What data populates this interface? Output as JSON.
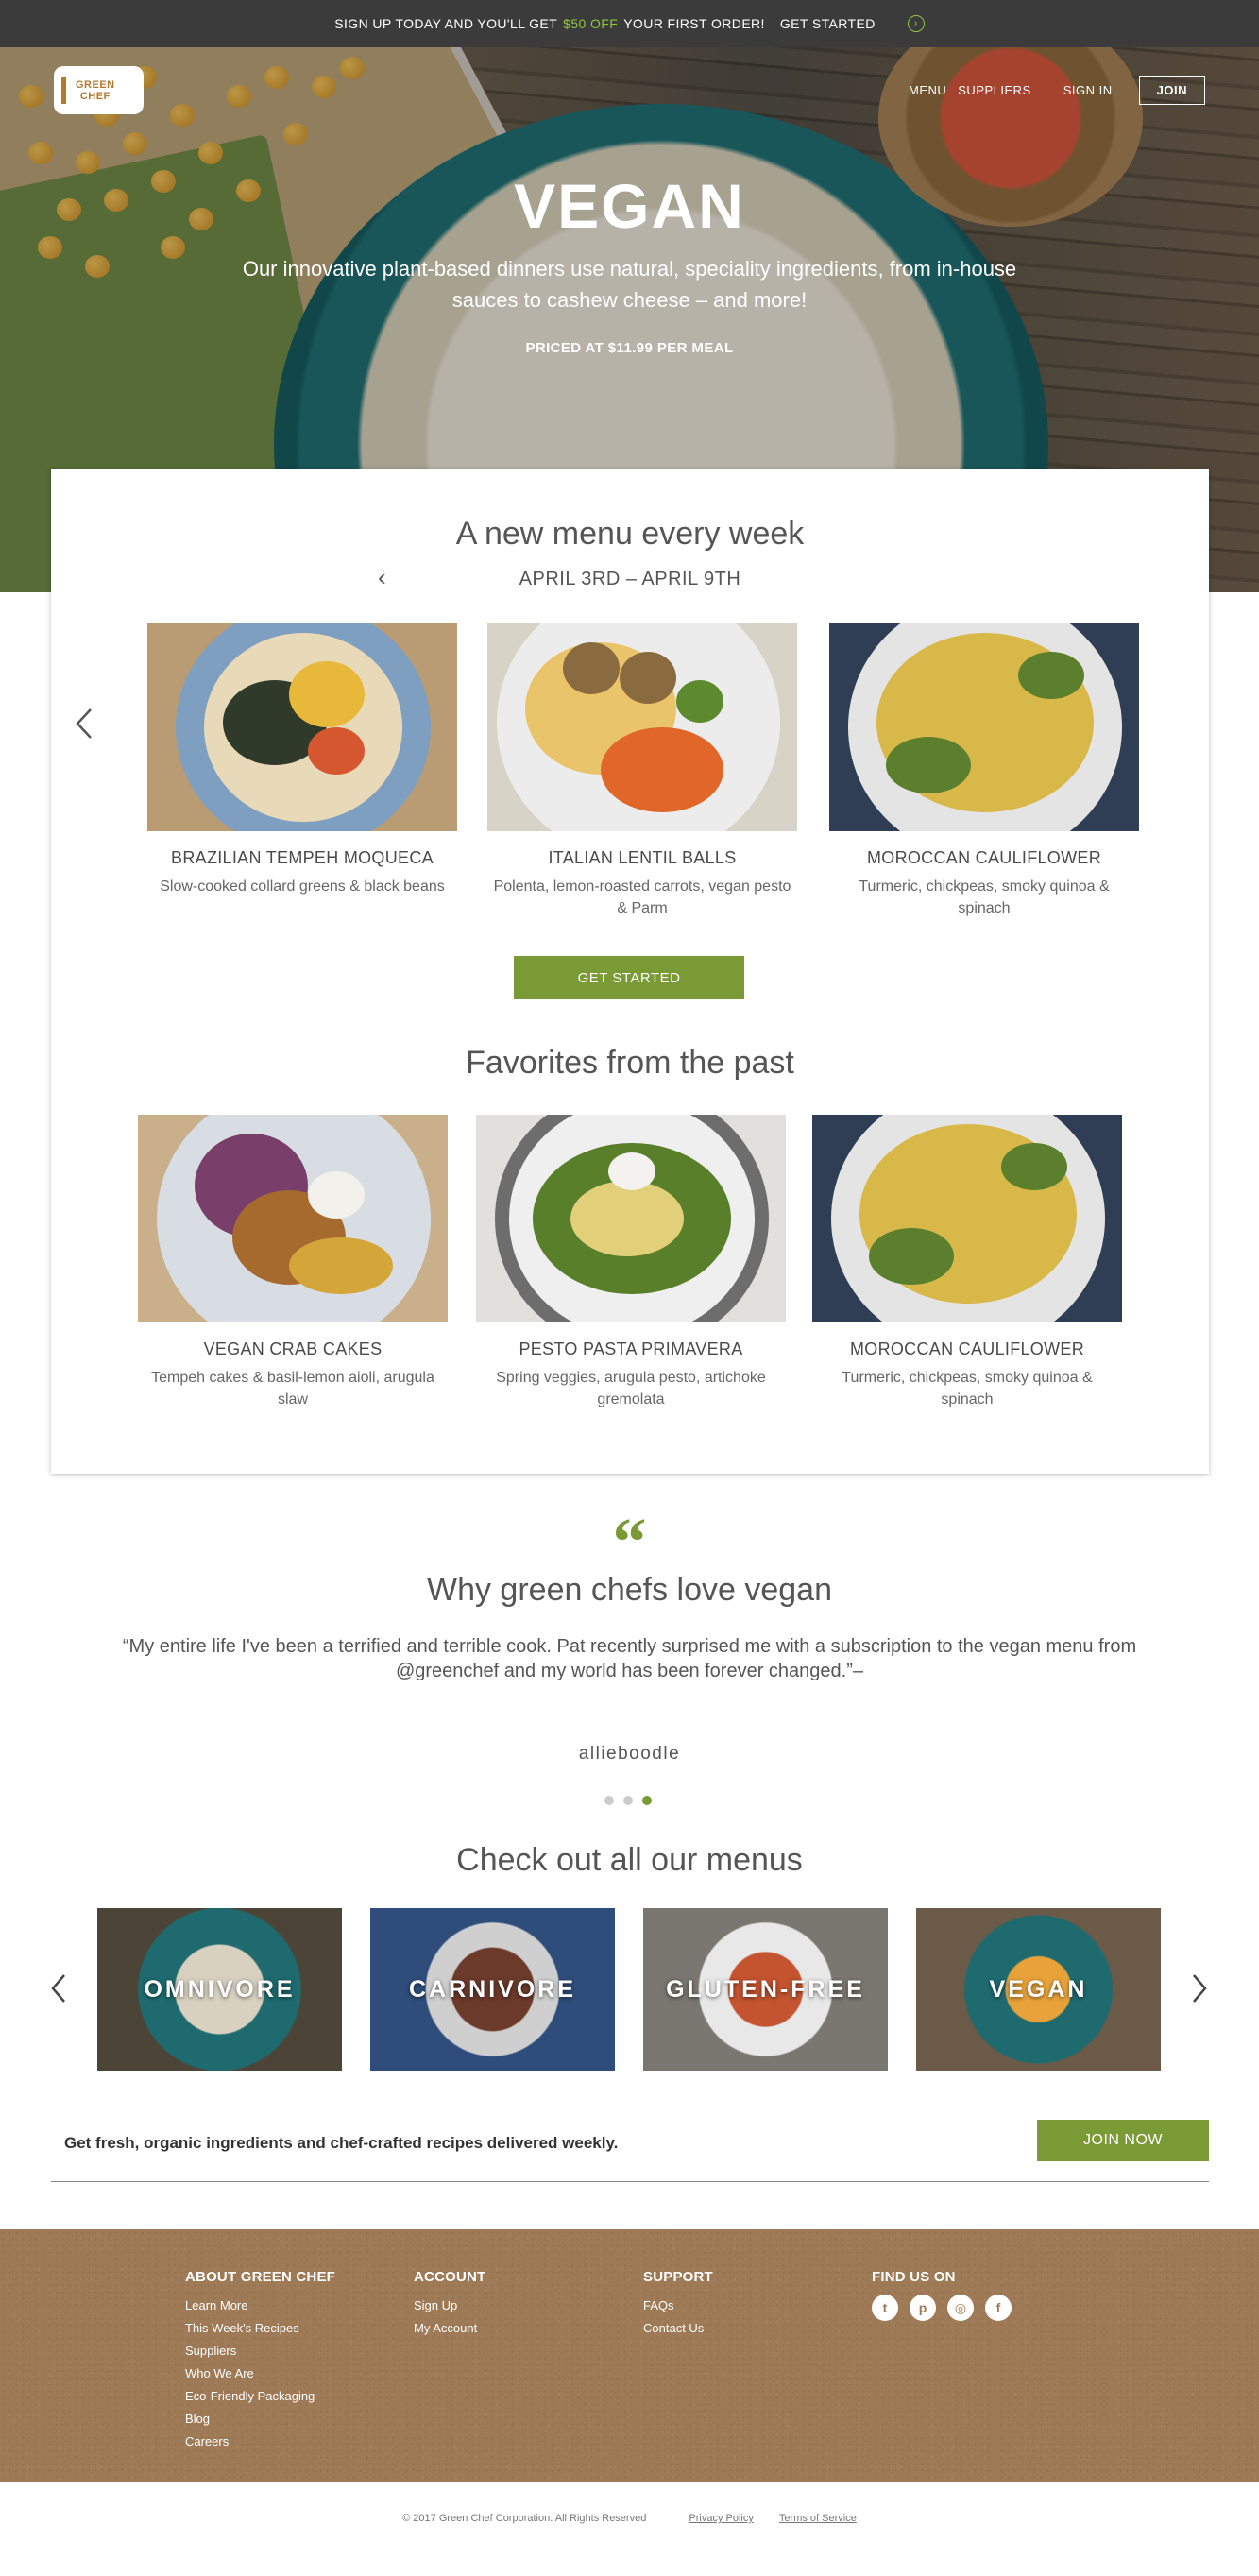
{
  "promo": {
    "before": "SIGN UP TODAY AND YOU'LL GET",
    "highlight": "$50 OFF",
    "after": "YOUR FIRST ORDER!",
    "cta": "GET STARTED",
    "arrow_icon": "chevron-right-circle-icon"
  },
  "logo": {
    "line1": "GREEN",
    "line2": "CHEF"
  },
  "nav": {
    "menu": "MENU",
    "suppliers": "SUPPLIERS",
    "signin": "SIGN IN",
    "join": "JOIN"
  },
  "hero": {
    "title": "VEGAN",
    "subtitle": "Our innovative plant-based dinners use natural, speciality ingredients, from in-house sauces to cashew cheese – and more!",
    "price": "PRICED AT $11.99 PER MEAL"
  },
  "weekly": {
    "title": "A new menu every week",
    "range": "APRIL 3RD – APRIL 9TH",
    "dishes": [
      {
        "name": "BRAZILIAN TEMPEH MOQUECA",
        "desc": "Slow-cooked collard greens & black beans"
      },
      {
        "name": "ITALIAN LENTIL BALLS",
        "desc": "Polenta, lemon-roasted carrots, vegan pesto & Parm"
      },
      {
        "name": "MOROCCAN CAULIFLOWER",
        "desc": "Turmeric, chickpeas, smoky quinoa & spinach"
      }
    ],
    "cta": "GET STARTED"
  },
  "past": {
    "title": "Favorites from the past",
    "dishes": [
      {
        "name": "VEGAN CRAB CAKES",
        "desc": "Tempeh cakes & basil-lemon aioli, arugula slaw"
      },
      {
        "name": "PESTO PASTA PRIMAVERA",
        "desc": "Spring veggies, arugula pesto, artichoke gremolata"
      },
      {
        "name": "MOROCCAN CAULIFLOWER",
        "desc": "Turmeric, chickpeas, smoky quinoa & spinach"
      }
    ]
  },
  "testimonial": {
    "mark": "“",
    "title": "Why green chefs love vegan",
    "quote": "“My entire life I've been a terrified and terrible cook. Pat recently surprised me with a subscription to the vegan menu from @greenchef and my world has been forever changed.”–",
    "author": "allieboodle",
    "active_slide": 3,
    "slide_count": 3
  },
  "menus": {
    "title": "Check out all our menus",
    "tiles": [
      "OMNIVORE",
      "CARNIVORE",
      "GLUTEN-FREE",
      "VEGAN"
    ]
  },
  "signup_bar": {
    "message": "Get fresh, organic ingredients and chef-crafted recipes delivered weekly.",
    "button": "JOIN NOW"
  },
  "footer": {
    "about": {
      "heading": "ABOUT GREEN CHEF",
      "links": [
        "Learn More",
        "This Week's Recipes",
        "Suppliers",
        "Who We Are",
        "Eco-Friendly Packaging",
        "Blog",
        "Careers"
      ]
    },
    "account": {
      "heading": "ACCOUNT",
      "links": [
        "Sign Up",
        "My Account"
      ]
    },
    "support": {
      "heading": "SUPPORT",
      "links": [
        "FAQs",
        "Contact Us"
      ]
    },
    "social": {
      "heading": "FIND US ON",
      "icons": [
        "twitter-icon",
        "pinterest-icon",
        "instagram-icon",
        "facebook-icon"
      ]
    }
  },
  "legal": {
    "copyright": "© 2017 Green Chef Corporation. All Rights Reserved",
    "privacy": "Privacy Policy",
    "terms": "Terms of Service"
  },
  "colors": {
    "brand_green": "#7a9a35",
    "promo_bg": "#3b3b3b",
    "footer_brown": "#9f7a56"
  }
}
